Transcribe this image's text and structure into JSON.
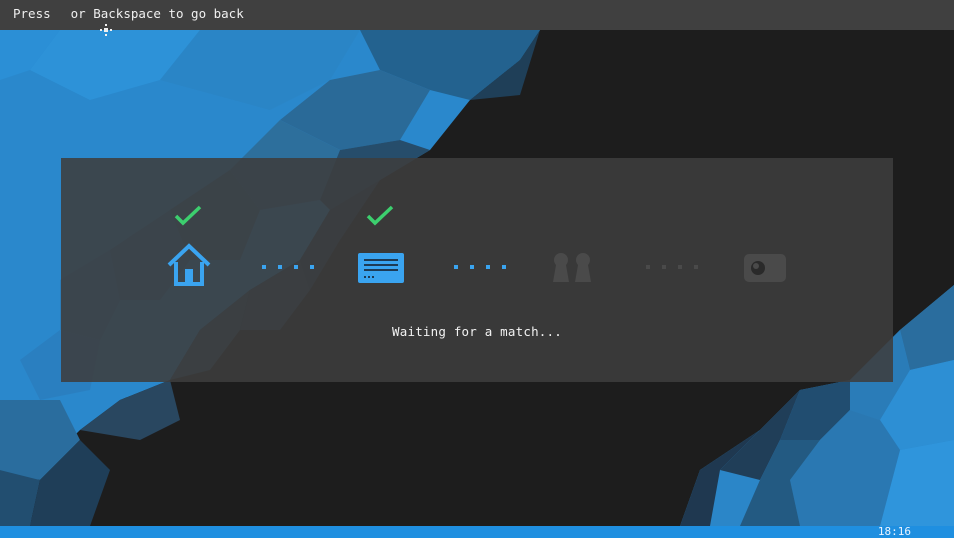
{
  "topbar": {
    "hint_prefix": "Press",
    "hint_icon": "gamepad-dpad-icon",
    "hint_suffix": "or Backspace to go back"
  },
  "steps": [
    {
      "icon": "home-icon",
      "state": "done",
      "color": "#3aa4f0"
    },
    {
      "icon": "server-list-icon",
      "state": "done",
      "color": "#3aa4f0"
    },
    {
      "icon": "players-icon",
      "state": "pending",
      "color": "#4a4a4a"
    },
    {
      "icon": "game-icon",
      "state": "pending",
      "color": "#4a4a4a"
    }
  ],
  "colors": {
    "accent": "#3aa4f0",
    "check": "#3ccf6e",
    "inactive": "#4a4a4a",
    "bottombar": "#1f8fe0"
  },
  "status": {
    "text": "Waiting for a match..."
  },
  "footer": {
    "clock": "18:16"
  }
}
